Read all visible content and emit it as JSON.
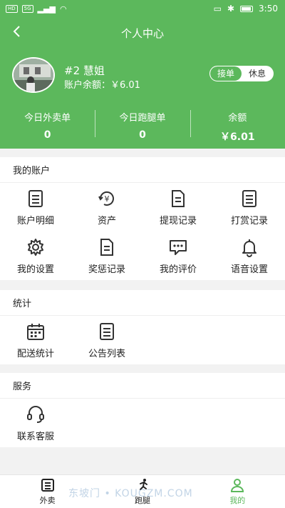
{
  "status_bar": {
    "left_icons": [
      "HD",
      "5G"
    ],
    "time": "3:50"
  },
  "header": {
    "title": "个人中心",
    "name": "#2 慧姐",
    "balance_text": "账户余额：￥6.01",
    "toggle": {
      "on_label": "接单",
      "off_label": "休息"
    }
  },
  "stats": [
    {
      "label": "今日外卖单",
      "value": "0"
    },
    {
      "label": "今日跑腿单",
      "value": "0"
    },
    {
      "label": "余额",
      "value": "￥6.01"
    }
  ],
  "sections": {
    "account": {
      "title": "我的账户",
      "items": [
        {
          "label": "账户明细",
          "icon": "list-doc-icon"
        },
        {
          "label": "资产",
          "icon": "yen-refresh-icon"
        },
        {
          "label": "提现记录",
          "icon": "doc-icon"
        },
        {
          "label": "打赏记录",
          "icon": "list-doc-icon"
        },
        {
          "label": "我的设置",
          "icon": "gear-icon"
        },
        {
          "label": "奖惩记录",
          "icon": "doc-icon"
        },
        {
          "label": "我的评价",
          "icon": "comment-icon"
        },
        {
          "label": "语音设置",
          "icon": "bell-icon"
        }
      ]
    },
    "stats": {
      "title": "统计",
      "items": [
        {
          "label": "配送统计",
          "icon": "calendar-icon"
        },
        {
          "label": "公告列表",
          "icon": "list-doc-icon"
        }
      ]
    },
    "service": {
      "title": "服务",
      "items": [
        {
          "label": "联系客服",
          "icon": "headset-icon"
        }
      ]
    }
  },
  "tabbar": [
    {
      "label": "外卖",
      "icon": "takeout-icon"
    },
    {
      "label": "跑腿",
      "icon": "runner-icon"
    },
    {
      "label": "我的",
      "icon": "user-icon",
      "active": true
    }
  ],
  "watermark": "东坡门 • KOUGZM.COM",
  "colors": {
    "brand": "#5cb85c"
  }
}
